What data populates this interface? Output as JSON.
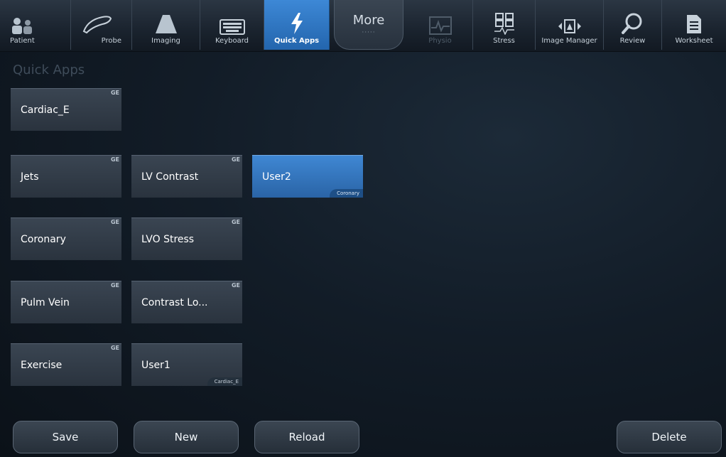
{
  "toolbar": {
    "items": [
      {
        "label": "Patient",
        "icon": "patient-icon"
      },
      {
        "label": "Probe",
        "icon": "probe-icon"
      },
      {
        "label": "Imaging",
        "icon": "imaging-icon"
      },
      {
        "label": "Keyboard",
        "icon": "keyboard-icon"
      },
      {
        "label": "Quick Apps",
        "icon": "lightning-icon"
      },
      {
        "label": "More",
        "icon": "more-dots-icon"
      },
      {
        "label": "Physio",
        "icon": "physio-icon"
      },
      {
        "label": "Stress",
        "icon": "stress-icon"
      },
      {
        "label": "Image Manager",
        "icon": "image-manager-icon"
      },
      {
        "label": "Review",
        "icon": "review-icon"
      },
      {
        "label": "Worksheet",
        "icon": "worksheet-icon"
      }
    ],
    "more_dots": "·····"
  },
  "section": {
    "title": "Quick Apps"
  },
  "tiles": [
    {
      "label": "Cardiac_E",
      "badge": "GE"
    },
    {
      "label": "Jets",
      "badge": "GE"
    },
    {
      "label": "LV Contrast",
      "badge": "GE"
    },
    {
      "label": "User2",
      "sub": "Coronary"
    },
    {
      "label": "Coronary",
      "badge": "GE"
    },
    {
      "label": "LVO Stress",
      "badge": "GE"
    },
    {
      "label": "Pulm Vein",
      "badge": "GE"
    },
    {
      "label": "Contrast Lo...",
      "badge": "GE"
    },
    {
      "label": "Exercise",
      "badge": "GE"
    },
    {
      "label": "User1",
      "sub": "Cardiac_E"
    }
  ],
  "buttons": {
    "save": "Save",
    "new": "New",
    "reload": "Reload",
    "delete": "Delete"
  },
  "colors": {
    "accent": "#2f74c0",
    "background": "#121c27",
    "tile": "#323c48"
  }
}
